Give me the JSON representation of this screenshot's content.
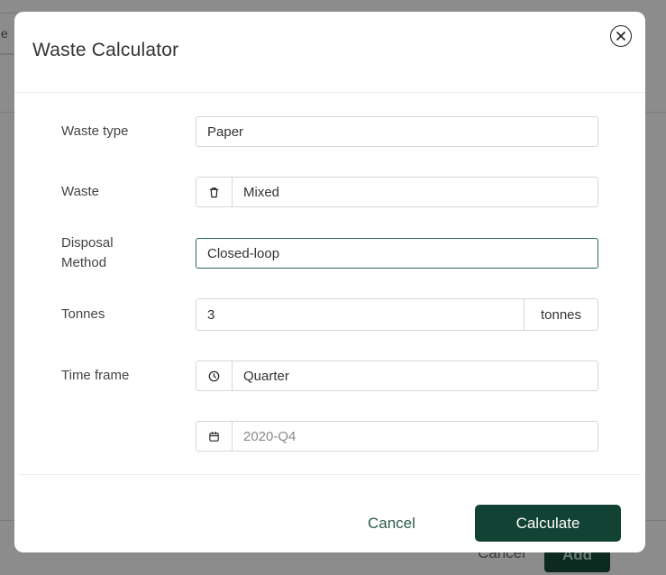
{
  "background": {
    "topbar_input_fragment": "e",
    "footer_cancel": "Cancel",
    "footer_add": "Add"
  },
  "modal": {
    "title": "Waste Calculator",
    "close_icon": "close-circle-icon",
    "fields": {
      "waste_type": {
        "label": "Waste type",
        "value": "Paper"
      },
      "waste": {
        "label": "Waste",
        "value": "Mixed",
        "icon": "trash-icon"
      },
      "disposal_method": {
        "label_line1": "Disposal",
        "label_line2": "Method",
        "value": "Closed-loop"
      },
      "tonnes": {
        "label": "Tonnes",
        "value": "3",
        "unit": "tonnes"
      },
      "time_frame": {
        "label": "Time frame",
        "value": "Quarter",
        "icon": "clock-icon"
      },
      "period": {
        "placeholder": "2020-Q4",
        "icon": "calendar-icon"
      }
    },
    "buttons": {
      "cancel": "Cancel",
      "calculate": "Calculate"
    },
    "colors": {
      "primary": "#124233",
      "focus_border": "#2c6a55",
      "cancel_text": "#2e5a4b"
    }
  }
}
